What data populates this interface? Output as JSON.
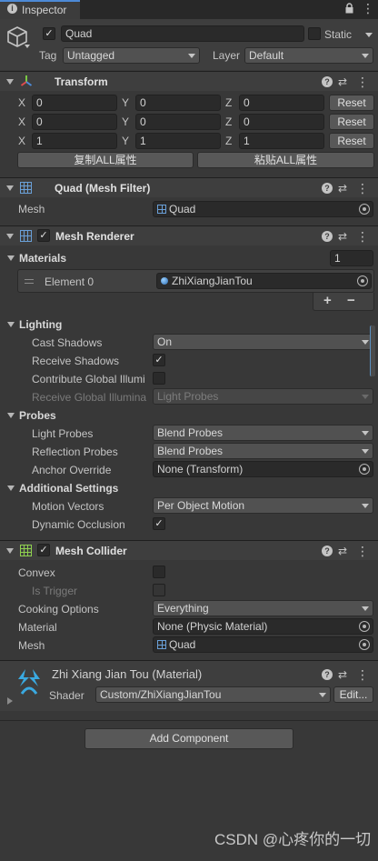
{
  "window": {
    "tab_label": "Inspector"
  },
  "object": {
    "name": "Quad",
    "static_label": "Static",
    "tag_label": "Tag",
    "tag_value": "Untagged",
    "layer_label": "Layer",
    "layer_value": "Default"
  },
  "transform": {
    "title": "Transform",
    "rows": [
      {
        "x": "0",
        "y": "0",
        "z": "0"
      },
      {
        "x": "0",
        "y": "0",
        "z": "0"
      },
      {
        "x": "1",
        "y": "1",
        "z": "1"
      }
    ],
    "axis_x": "X",
    "axis_y": "Y",
    "axis_z": "Z",
    "reset_label": "Reset",
    "copy_all_label": "复制ALL属性",
    "paste_all_label": "粘贴ALL属性"
  },
  "mesh_filter": {
    "title": "Quad (Mesh Filter)",
    "mesh_label": "Mesh",
    "mesh_value": "Quad"
  },
  "mesh_renderer": {
    "title": "Mesh Renderer",
    "materials_label": "Materials",
    "materials_count": "1",
    "element0_label": "Element 0",
    "element0_value": "ZhiXiangJianTou",
    "plus_label": "+",
    "minus_label": "−",
    "lighting_label": "Lighting",
    "cast_shadows_label": "Cast Shadows",
    "cast_shadows_value": "On",
    "receive_shadows_label": "Receive Shadows",
    "contribute_gi_label": "Contribute Global Illumi",
    "receive_gi_label": "Receive Global Illumina",
    "receive_gi_value": "Light Probes",
    "probes_label": "Probes",
    "light_probes_label": "Light Probes",
    "light_probes_value": "Blend Probes",
    "reflection_probes_label": "Reflection Probes",
    "reflection_probes_value": "Blend Probes",
    "anchor_override_label": "Anchor Override",
    "anchor_override_value": "None (Transform)",
    "additional_label": "Additional Settings",
    "motion_vectors_label": "Motion Vectors",
    "motion_vectors_value": "Per Object Motion",
    "dynamic_occlusion_label": "Dynamic Occlusion"
  },
  "mesh_collider": {
    "title": "Mesh Collider",
    "convex_label": "Convex",
    "is_trigger_label": "Is Trigger",
    "cooking_label": "Cooking Options",
    "cooking_value": "Everything",
    "material_label": "Material",
    "material_value": "None (Physic Material)",
    "mesh_label": "Mesh",
    "mesh_value": "Quad"
  },
  "material": {
    "title": "Zhi Xiang Jian Tou (Material)",
    "shader_label": "Shader",
    "shader_value": "Custom/ZhiXiangJianTou",
    "edit_label": "Edit..."
  },
  "add_component_label": "Add Component",
  "watermark": "CSDN @心疼你的一切",
  "colors": {
    "bg": "#383838",
    "header": "#3e3e3e",
    "field": "#2a2a2a",
    "accent_blue": "#4d8ad6"
  }
}
